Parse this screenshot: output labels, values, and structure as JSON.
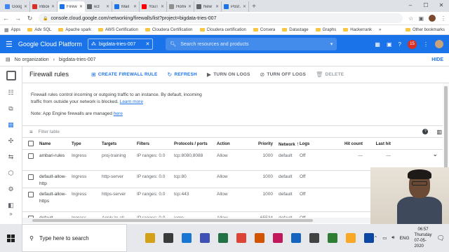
{
  "browser": {
    "tabs": [
      {
        "label": "Google S",
        "color": "#4285f4",
        "active": false
      },
      {
        "label": "Inbox (4)",
        "color": "#d93025",
        "active": false
      },
      {
        "label": "Firewall r",
        "color": "#1a73e8",
        "active": true
      },
      {
        "label": "w3",
        "color": "#5f6368",
        "active": false
      },
      {
        "label": "Mail",
        "color": "#1a73e8",
        "active": false
      },
      {
        "label": "YouTube",
        "color": "#ff0000",
        "active": false
      },
      {
        "label": "Home -",
        "color": "#8f8f8f",
        "active": false
      },
      {
        "label": "New Tab",
        "color": "#5f6368",
        "active": false
      },
      {
        "label": "Post Atte",
        "color": "#1a73e8",
        "active": false
      }
    ],
    "new_tab_glyph": "+",
    "window_controls": [
      "–",
      "☐",
      "✕"
    ],
    "url": "console.cloud.google.com/networking/firewalls/list?project=bigdata-tries-007",
    "bookmarks": [
      {
        "label": "Apps",
        "kind": "apps"
      },
      {
        "label": "Adv SQL",
        "kind": "folder"
      },
      {
        "label": "Apache spark",
        "kind": "folder"
      },
      {
        "label": "AWS Certification",
        "kind": "folder"
      },
      {
        "label": "Cloudera Certification",
        "kind": "folder"
      },
      {
        "label": "Cloudera certification",
        "kind": "folder"
      },
      {
        "label": "Corsera",
        "kind": "folder"
      },
      {
        "label": "Datastage",
        "kind": "folder"
      },
      {
        "label": "Graphs",
        "kind": "folder"
      },
      {
        "label": "Hackerrank",
        "kind": "folder"
      }
    ],
    "other_bookmarks": "Other bookmarks"
  },
  "gcp": {
    "brand": "Google Cloud Platform",
    "project": "bigdata-tries-007",
    "search_placeholder": "Search resources and products",
    "notification_count": "15",
    "org_label": "No organization",
    "org_project": "bigdata-tries-007",
    "hide_label": "HIDE"
  },
  "toolbar": {
    "title": "Firewall rules",
    "create_label": "CREATE FIREWALL RULE",
    "refresh_label": "REFRESH",
    "turn_on_logs_label": "TURN ON LOGS",
    "turn_off_logs_label": "TURN OFF LOGS",
    "delete_label": "DELETE"
  },
  "content": {
    "desc_1": "Firewall rules control incoming or outgoing traffic to an instance. By default, incoming traffic from outside your network is blocked.",
    "learn_more": "Learn more",
    "note_text": "Note: App Engine firewalls are managed ",
    "note_link": "here",
    "filter_placeholder": "Filter table"
  },
  "table": {
    "columns": [
      "Name",
      "Type",
      "Targets",
      "Filters",
      "Protocols / ports",
      "Action",
      "Priority",
      "Network",
      "Logs",
      "Hit count",
      "Last hit"
    ],
    "sort_arrow": "↑",
    "rows": [
      {
        "name": "ambari-rules",
        "type": "Ingress",
        "targets": "proj-training",
        "filters": "IP ranges: 0.0",
        "ports": "tcp:8080,8088",
        "action": "Allow",
        "priority": "1000",
        "network": "default",
        "logs": "Off",
        "hits": "—",
        "last": "—"
      },
      {
        "name": "default-allow-http",
        "type": "Ingress",
        "targets": "http-server",
        "filters": "IP ranges: 0.0",
        "ports": "tcp:80",
        "action": "Allow",
        "priority": "1000",
        "network": "default",
        "logs": "Off",
        "hits": "",
        "last": ""
      },
      {
        "name": "default-allow-https",
        "type": "Ingress",
        "targets": "https-server",
        "filters": "IP ranges: 0.0",
        "ports": "tcp:443",
        "action": "Allow",
        "priority": "1000",
        "network": "default",
        "logs": "Off",
        "hits": "",
        "last": ""
      },
      {
        "name": "default-",
        "type": "Ingress",
        "targets": "Apply to all",
        "filters": "IP ranges: 0.0",
        "ports": "icmp",
        "action": "Allow",
        "priority": "65534",
        "network": "default",
        "logs": "Off",
        "hits": "",
        "last": ""
      }
    ]
  },
  "taskbar": {
    "search_placeholder": "Type here to search",
    "apps": [
      "#d4a017",
      "#3a3a3a",
      "#1976d2",
      "#3f51b5",
      "#217346",
      "#db4437",
      "#d35400",
      "#c2185b",
      "#1565c0",
      "#424242",
      "#2e7d32",
      "#f9a825",
      "#0d47a1"
    ],
    "language": "ENG",
    "time": "06:57",
    "day": "Thursday",
    "date": "07-05-2020"
  }
}
